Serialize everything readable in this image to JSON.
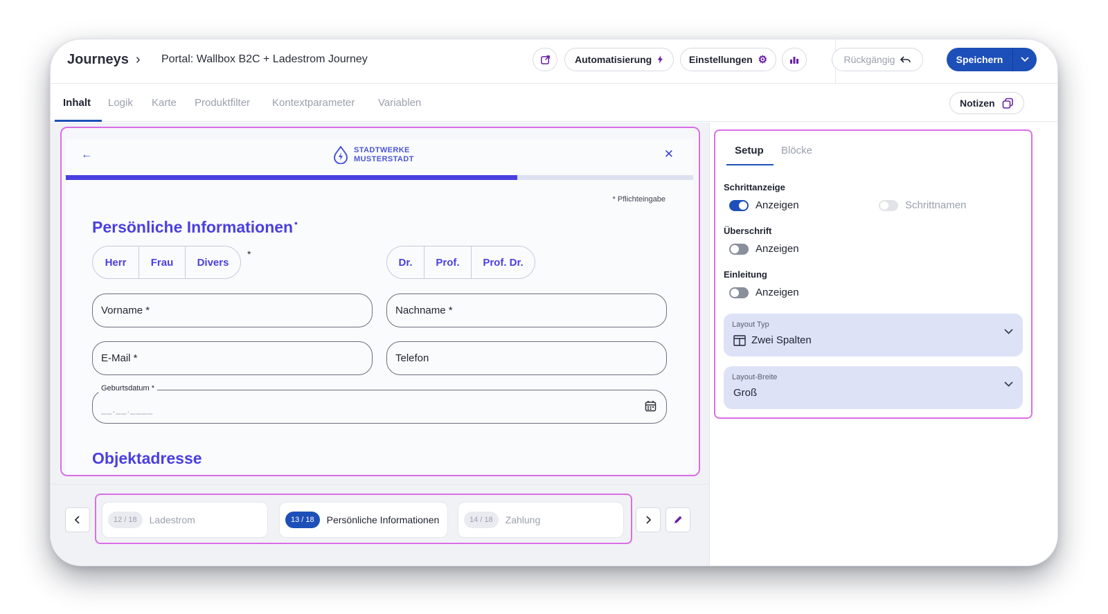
{
  "header": {
    "breadcrumb_root": "Journeys",
    "breadcrumb_sep": "›",
    "breadcrumb_current": "Portal: Wallbox B2C + Ladestrom Journey",
    "automation_label": "Automatisierung",
    "settings_label": "Einstellungen",
    "undo_label": "Rückgängig",
    "save_label": "Speichern"
  },
  "tabs": [
    {
      "label": "Inhalt",
      "active": true
    },
    {
      "label": "Logik"
    },
    {
      "label": "Karte"
    },
    {
      "label": "Produktfilter"
    },
    {
      "label": "Kontextparameter"
    },
    {
      "label": "Variablen"
    }
  ],
  "notes_label": "Notizen",
  "preview": {
    "back_icon": "←",
    "close_icon": "✕",
    "logo_line1": "STADTWERKE",
    "logo_line2": "MUSTERSTADT",
    "progress_value": 0.72,
    "required_note": "* Pflichteingabe",
    "section_title": "Persönliche Informationen",
    "section_title_marker": "•",
    "salutations": [
      "Herr",
      "Frau",
      "Divers"
    ],
    "salutation_required": "*",
    "titles": [
      "Dr.",
      "Prof.",
      "Prof. Dr."
    ],
    "firstname_label": "Vorname *",
    "lastname_label": "Nachname *",
    "email_label": "E-Mail *",
    "phone_label": "Telefon",
    "birthdate_label": "Geburtsdatum *",
    "birthdate_mask": "__.__.____",
    "address_title": "Objektadresse"
  },
  "steps": [
    {
      "badge": "12 / 18",
      "label": "Ladestrom"
    },
    {
      "badge": "13 / 18",
      "label": "Persönliche Informationen"
    },
    {
      "badge": "14 / 18",
      "label": "Zahlung"
    }
  ],
  "panel": {
    "tab_setup": "Setup",
    "tab_blocks": "Blöcke",
    "step_display_label": "Schrittanzeige",
    "step_display_toggle": "Anzeigen",
    "step_names_toggle": "Schrittnamen",
    "heading_label": "Überschrift",
    "heading_toggle": "Anzeigen",
    "intro_label": "Einleitung",
    "intro_toggle": "Anzeigen",
    "layout_type_label": "Layout Typ",
    "layout_type_value": "Zwei Spalten",
    "layout_width_label": "Layout-Breite",
    "layout_width_value": "Groß"
  },
  "colors": {
    "primary": "#1d4fb8",
    "accent_purple": "#4a3fe0",
    "highlight_frame": "#d96ee6"
  }
}
